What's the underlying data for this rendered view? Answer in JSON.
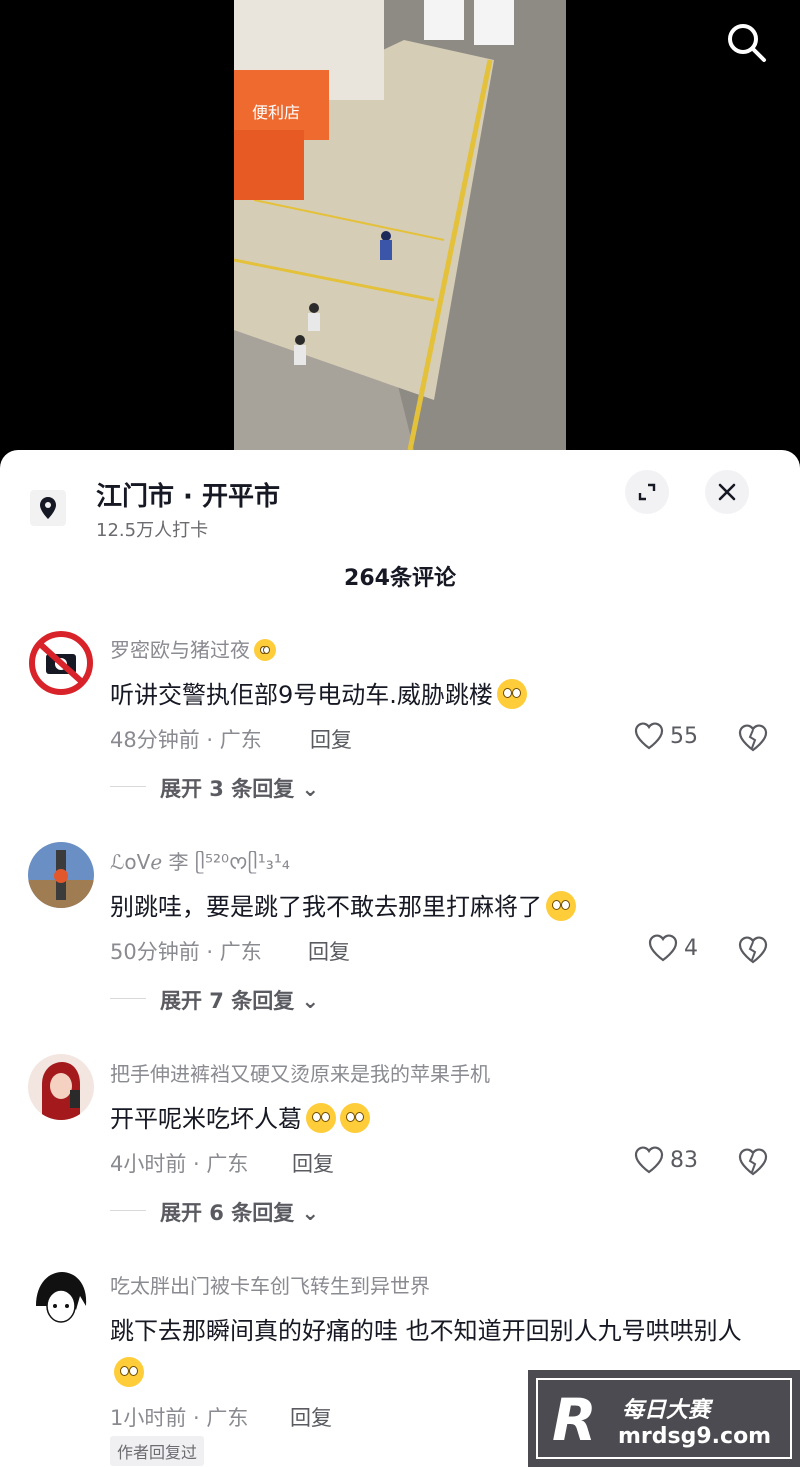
{
  "location": {
    "title": "江门市 · 开平市",
    "subtitle": "12.5万人打卡"
  },
  "comments_count": "264条评论",
  "comments": [
    {
      "user": "罗密欧与猪过夜",
      "text": "听讲交警执佢部9号电动车.威胁跳楼",
      "time_region": "48分钟前 · 广东",
      "reply": "回复",
      "likes": "55",
      "expand": "展开 3 条回复"
    },
    {
      "user": "ℒoVℯ 李 ᥫ⁵²⁰ᰔᥫ¹₃¹₄",
      "text": "别跳哇，要是跳了我不敢去那里打麻将了",
      "time_region": "50分钟前 · 广东",
      "reply": "回复",
      "likes": "4",
      "expand": "展开 7 条回复"
    },
    {
      "user": "把手伸进裤裆又硬又烫原来是我的苹果手机",
      "text": "开平呢米吃坏人葛",
      "time_region": "4小时前 · 广东",
      "reply": "回复",
      "likes": "83",
      "expand": "展开 6 条回复"
    },
    {
      "user": "吃太胖出门被卡车创飞转生到异世界",
      "text": "跳下去那瞬间真的好痛的哇 也不知道开回别人九号哄哄别人",
      "time_region": "1小时前 · 广东",
      "reply": "回复",
      "tag": "作者回复过"
    }
  ],
  "video": {
    "sign_text": "便利店"
  },
  "watermark": {
    "logo_letter": "R",
    "brand": "每日大赛",
    "url": "mrdsg9.com"
  },
  "icons": {
    "search": "search-icon",
    "pin": "location-pin-icon",
    "expand": "expand-icon",
    "close": "close-icon",
    "heart": "heart-icon",
    "dislike": "broken-heart-icon"
  },
  "colors": {
    "sheet_bg": "#ffffff",
    "primary_text": "#161823",
    "secondary_text": "#8a8b91"
  }
}
